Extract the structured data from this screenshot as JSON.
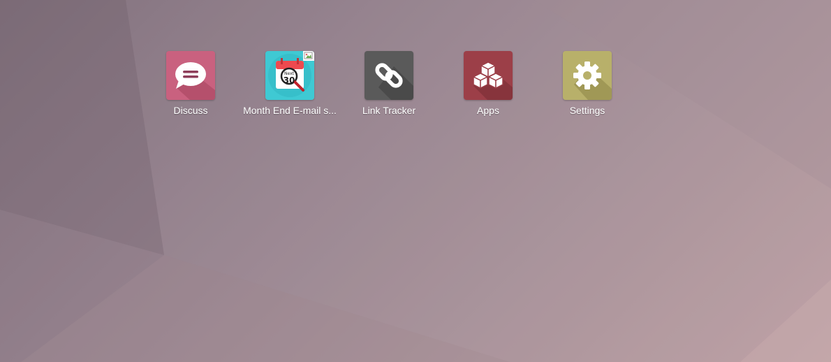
{
  "apps": [
    {
      "label": "Discuss",
      "icon": "speech-bubble-icon",
      "color": "#c9617f"
    },
    {
      "label": "Month End E-mail s...",
      "icon": "calendar-search-icon",
      "color": "#3fc9d3"
    },
    {
      "label": "Link Tracker",
      "icon": "chain-link-icon",
      "color": "#5a5a5a"
    },
    {
      "label": "Apps",
      "icon": "cubes-icon",
      "color": "#9c3f48"
    },
    {
      "label": "Settings",
      "icon": "gear-icon",
      "color": "#b8b06a"
    }
  ],
  "month_end_icon_text": {
    "top": "Next",
    "number": "30"
  }
}
